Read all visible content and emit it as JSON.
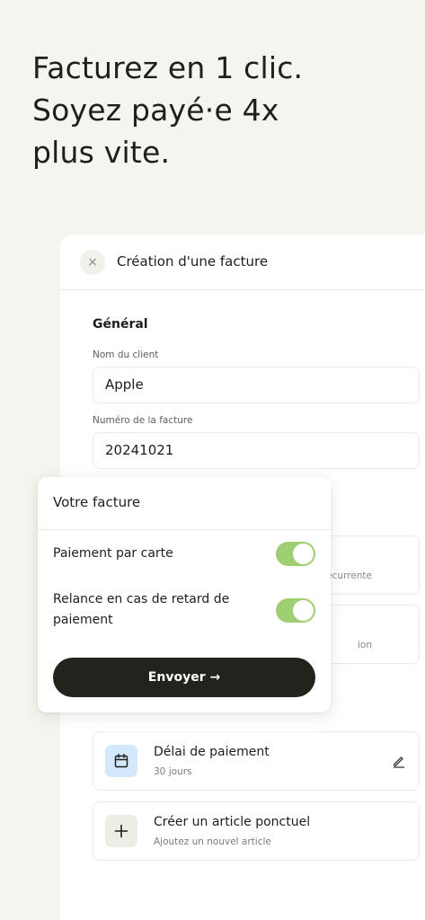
{
  "headline": {
    "line1": "Facturez en 1 clic.",
    "line2": "Soyez payé·e 4x",
    "line3": "plus vite."
  },
  "invoice_panel": {
    "close_glyph": "×",
    "title": "Création d'une facture",
    "section_general": "Général",
    "client_name_label": "Nom du client",
    "client_name_value": "Apple",
    "invoice_number_label": "Numéro de la facture",
    "invoice_number_value": "20241021",
    "hidden_card1_sub": "ecurrente",
    "hidden_card2_sub": "ion",
    "payment_delay": {
      "title": "Délai de paiement",
      "subtitle": "30 jours",
      "icon": "calendar-icon"
    },
    "create_item": {
      "title": "Créer un article ponctuel",
      "subtitle": "Ajoutez un nouvel article",
      "icon": "plus-icon"
    }
  },
  "overlay": {
    "title": "Votre facture",
    "card_payment_label": "Paiement par carte",
    "card_payment_enabled": true,
    "reminder_label": "Relance en cas de retard de paiement",
    "reminder_enabled": true,
    "send_label": "Envoyer →"
  },
  "colors": {
    "background": "#f5f4ef",
    "toggle_on": "#9fcf73",
    "button_dark": "#23221d",
    "calendar_bg": "#d3e8fb"
  }
}
